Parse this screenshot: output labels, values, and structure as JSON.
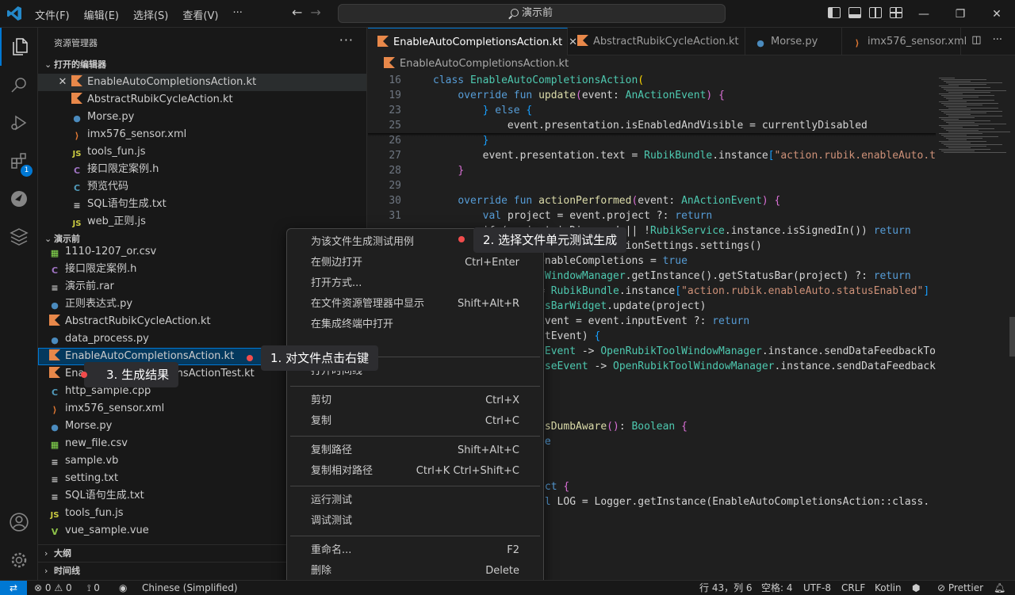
{
  "menu": [
    "文件(F)",
    "编辑(E)",
    "选择(S)",
    "查看(V)",
    "···"
  ],
  "search": {
    "text": "演示前"
  },
  "sidebar": {
    "title": "资源管理器",
    "more": "···",
    "open_editors_header": "打开的编辑器",
    "open_editors": [
      {
        "name": "EnableAutoCompletionsAction.kt",
        "icon": "kotlin-icon"
      },
      {
        "name": "AbstractRubikCycleAction.kt",
        "icon": "kotlin-icon"
      },
      {
        "name": "Morse.py",
        "icon": "python-icon"
      },
      {
        "name": "imx576_sensor.xml",
        "icon": "xml-icon"
      },
      {
        "name": "tools_fun.js",
        "icon": "js-icon"
      },
      {
        "name": "接口限定案例.h",
        "icon": "c-header-icon"
      },
      {
        "name": "预览代码",
        "icon": "cpp-icon"
      },
      {
        "name": "SQL语句生成.txt",
        "icon": "text-file-icon"
      },
      {
        "name": "web_正则.js",
        "icon": "js-icon"
      }
    ],
    "folder_header": "演示前",
    "files": [
      {
        "name": "1110-1207_or.csv",
        "icon": "csv-icon"
      },
      {
        "name": "接口限定案例.h",
        "icon": "c-header-icon"
      },
      {
        "name": "演示前.rar",
        "icon": "archive-icon"
      },
      {
        "name": "正则表达式.py",
        "icon": "python-icon"
      },
      {
        "name": "AbstractRubikCycleAction.kt",
        "icon": "kotlin-icon"
      },
      {
        "name": "data_process.py",
        "icon": "python-icon"
      },
      {
        "name": "EnableAutoCompletionsAction.kt",
        "icon": "kotlin-icon"
      },
      {
        "name": "EnableAutoCompletionsActionTest.kt",
        "icon": "kotlin-icon"
      },
      {
        "name": "http_sample.cpp",
        "icon": "cpp-icon"
      },
      {
        "name": "imx576_sensor.xml",
        "icon": "xml-icon"
      },
      {
        "name": "Morse.py",
        "icon": "python-icon"
      },
      {
        "name": "new_file.csv",
        "icon": "csv-icon"
      },
      {
        "name": "sample.vb",
        "icon": "text-file-icon"
      },
      {
        "name": "setting.txt",
        "icon": "text-file-icon"
      },
      {
        "name": "SQL语句生成.txt",
        "icon": "text-file-icon"
      },
      {
        "name": "tools_fun.js",
        "icon": "js-icon"
      },
      {
        "name": "vue_sample.vue",
        "icon": "vue-icon"
      }
    ],
    "outline_header": "大纲",
    "timeline_header": "时间线"
  },
  "tabs": [
    {
      "name": "EnableAutoCompletionsAction.kt",
      "active": true
    },
    {
      "name": "AbstractRubikCycleAction.kt",
      "active": false
    },
    {
      "name": "Morse.py",
      "active": false
    },
    {
      "name": "imx576_sensor.xml",
      "active": false
    }
  ],
  "breadcrumb": "EnableAutoCompletionsAction.kt",
  "code_lines": [
    {
      "n": "16",
      "html": "<span class='kw'>class</span> <span class='ty'>EnableAutoCompletionsAction</span><span class='br'>(</span>"
    },
    {
      "n": "19",
      "html": "    <span class='kw'>override fun</span> <span class='fn'>update</span><span class='br2'>(</span><span class='pl'>event: </span><span class='ty'>AnActionEvent</span><span class='br2'>)</span> <span class='br2'>{</span>"
    },
    {
      "n": "23",
      "html": "        <span class='br3'>}</span> <span class='kw'>else</span> <span class='br3'>{</span>"
    },
    {
      "n": "25",
      "html": "            <span class='pl'>event.presentation.isEnabledAndVisible = currentlyDisabled</span>"
    },
    {
      "n": "26",
      "html": "        <span class='br3'>}</span>"
    },
    {
      "n": "27",
      "html": "        <span class='pl'>event.presentation.text = </span><span class='ty'>RubikBundle</span><span class='pl'>.instance</span><span class='br3'>[</span><span class='st'>\"action.rubik.enableAuto.te</span>"
    },
    {
      "n": "28",
      "html": "    <span class='br2'>}</span>"
    },
    {
      "n": "29",
      "html": ""
    },
    {
      "n": "30",
      "html": "    <span class='kw'>override fun</span> <span class='fn'>actionPerformed</span><span class='br2'>(</span><span class='pl'>event: </span><span class='ty'>AnActionEvent</span><span class='br2'>)</span> <span class='br2'>{</span>"
    },
    {
      "n": "31",
      "html": "        <span class='kw'>val</span> <span class='pl'>project = event.project ?: </span><span class='kw'>return</span>"
    },
    {
      "n": "",
      "html": "        <span class='pl'>if (project.isDisposed || !</span><span class='ty'>RubikService</span><span class='pl'>.instance.isSignedIn()) </span><span class='kw'>return</span>"
    },
    {
      "n": "",
      "html": "        <span class='kw'>val</span> <span class='pl'>settings = ApplicationSettings.settings()</span>"
    },
    {
      "n": "",
      "html": "        <span class='pl'>settings.enableCompletions = </span><span class='kw'>true</span>"
    },
    {
      "n": "",
      "html": "        <span class='kw'>val</span> <span class='pl'>bar = </span><span class='ty'>WindowManager</span><span class='pl'>.getInstance().getStatusBar(project) ?: </span><span class='kw'>return</span>"
    },
    {
      "n": "",
      "html": "        <span class='pl'>bar.info = </span><span class='ty'>RubikBundle</span><span class='pl'>.instance</span><span class='br3'>[</span><span class='st'>\"action.rubik.enableAuto.statusEnabled\"</span><span class='br3'>]</span>"
    },
    {
      "n": "",
      "html": "        <span class='ty'>RubikStatusBarWidget</span><span class='pl'>.update(project)</span>"
    },
    {
      "n": "",
      "html": "        <span class='kw'>val</span> <span class='pl'>inputEvent = event.inputEvent ?: </span><span class='kw'>return</span>"
    },
    {
      "n": "",
      "html": "        <span class='kw'>when</span> <span class='pl'>(inputEvent)</span> <span class='br3'>{</span>"
    },
    {
      "n": "",
      "html": "            <span class='kw'>is</span> <span class='ty'>KeyEvent</span> <span class='pl'>-> </span><span class='ty'>OpenRubikToolWindowManager</span><span class='pl'>.instance.sendDataFeedbackToW</span>"
    },
    {
      "n": "",
      "html": "            <span class='kw'>is</span> <span class='ty'>MouseEvent</span> <span class='pl'>-> </span><span class='ty'>OpenRubikToolWindowManager</span><span class='pl'>.instance.sendDataFeedbackT</span>"
    },
    {
      "n": "",
      "html": ""
    },
    {
      "n": "",
      "html": ""
    },
    {
      "n": "",
      "html": ""
    },
    {
      "n": "",
      "html": "    <span class='kw'>override fun</span> <span class='fn'>isDumbAware</span><span class='br2'>()</span><span class='pl'>: </span><span class='ty'>Boolean</span> <span class='br2'>{</span>"
    },
    {
      "n": "",
      "html": "        <span class='kw'>return</span> <span class='kw'>true</span>"
    },
    {
      "n": "",
      "html": ""
    },
    {
      "n": "",
      "html": ""
    },
    {
      "n": "",
      "html": "    <span class='kw'>companion object</span> <span class='br2'>{</span>"
    },
    {
      "n": "",
      "html": "        <span class='kw'>private val</span> <span class='pl'>LOG = Logger.getInstance(EnableAutoCompletionsAction::class.</span>"
    }
  ],
  "context_menu": [
    {
      "label": "为该文件生成测试用例",
      "key": ""
    },
    {
      "label": "在侧边打开",
      "key": "Ctrl+Enter"
    },
    {
      "label": "打开方式...",
      "key": ""
    },
    {
      "label": "在文件资源管理器中显示",
      "key": "Shift+Alt+R"
    },
    {
      "label": "在集成终端中打开",
      "key": ""
    },
    {
      "label": "打开时间线",
      "key": ""
    },
    {
      "label": "剪切",
      "key": "Ctrl+X"
    },
    {
      "label": "复制",
      "key": "Ctrl+C"
    },
    {
      "label": "复制路径",
      "key": "Shift+Alt+C"
    },
    {
      "label": "复制相对路径",
      "key": "Ctrl+K Ctrl+Shift+C"
    },
    {
      "label": "运行测试",
      "key": ""
    },
    {
      "label": "调试测试",
      "key": ""
    },
    {
      "label": "重命名...",
      "key": "F2"
    },
    {
      "label": "删除",
      "key": "Delete"
    }
  ],
  "annotations": {
    "step1": "1. 对文件点击右键",
    "step2": "2. 选择文件单元测试生成",
    "step3": "3. 生成结果"
  },
  "status": {
    "errors": "0",
    "warnings": "0",
    "ports": "0",
    "language_pack": "Chinese (Simplified)",
    "position": "行 43，列 6",
    "spaces": "空格: 4",
    "encoding": "UTF-8",
    "eol": "CRLF",
    "language": "Kotlin",
    "formatter": "Prettier"
  },
  "colors": {
    "accent": "#0078d4",
    "annotation_dot": "#f14c4c"
  }
}
